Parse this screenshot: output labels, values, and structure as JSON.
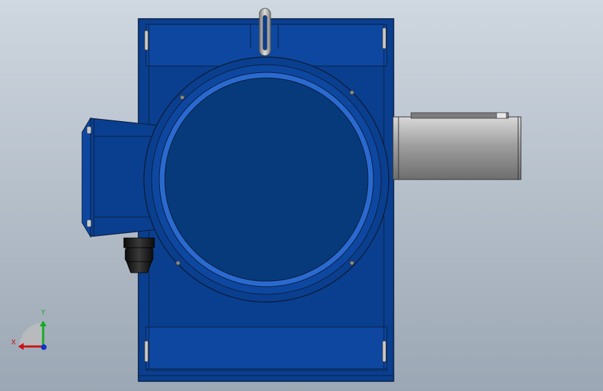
{
  "viewport": {
    "background_top": "#cfd7e0",
    "background_bottom": "#9aa6b3",
    "model_color": "#0a3f8f",
    "model_dark": "#083473",
    "model_edge": "#0b1f40",
    "shaft_color": "#9a9a9a",
    "gland_color": "#1b1b1b",
    "eyebolt_color": "#a8a8a8"
  },
  "triad": {
    "x_label": "X",
    "y_label": "Y",
    "x_color": "#cc1111",
    "y_color": "#11aa22",
    "z_color": "#1133cc"
  }
}
